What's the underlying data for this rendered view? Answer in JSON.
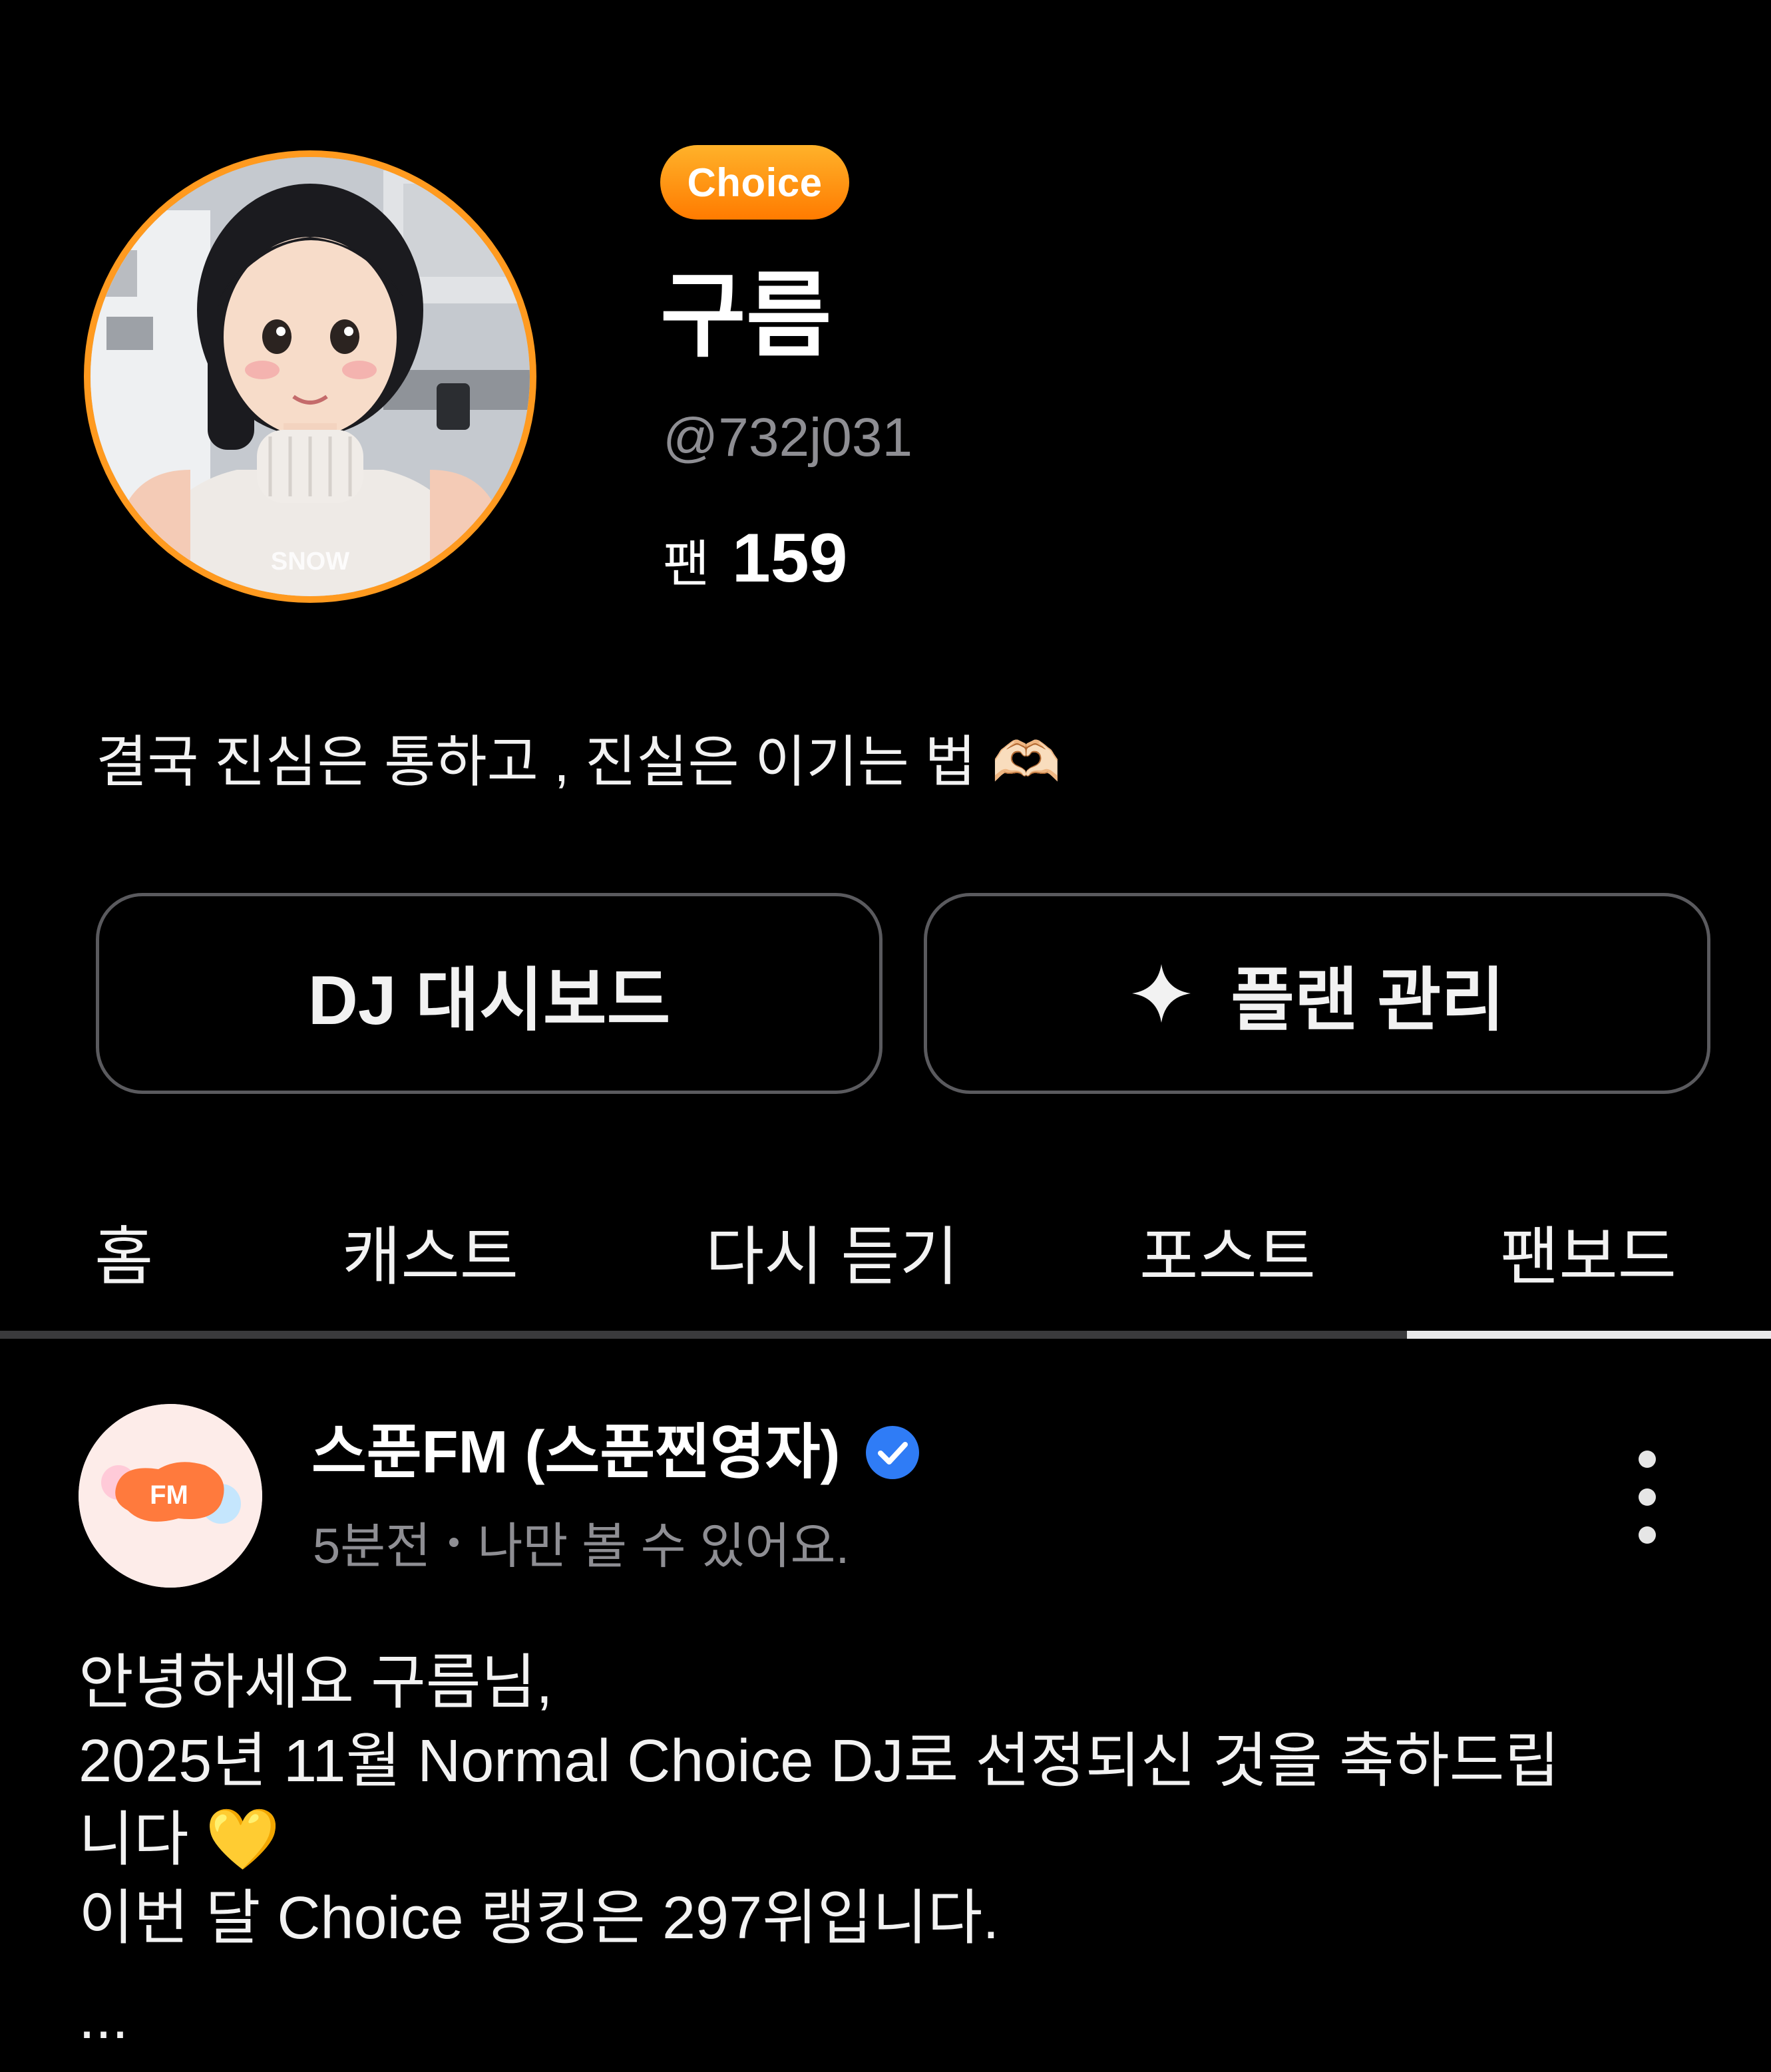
{
  "profile": {
    "badge": "Choice",
    "nickname": "구름",
    "handle": "@732j031",
    "fans_label": "팬",
    "fans_count": "159",
    "avatar_watermark": "SNOW",
    "bio": "결국 진심은 통하고 , 진실은 이기는 법",
    "bio_emoji": "🫶🏻"
  },
  "buttons": {
    "dj_dashboard": "DJ 대시보드",
    "plan_manage": "플랜 관리"
  },
  "tabs": [
    {
      "label": "홈"
    },
    {
      "label": "캐스트"
    },
    {
      "label": "다시 듣기"
    },
    {
      "label": "포스트"
    },
    {
      "label": "팬보드"
    }
  ],
  "active_tab": "팬보드",
  "post": {
    "author": "스푼FM (스푼찐영자)",
    "avatar_text": "FM",
    "time": "5분전",
    "visibility": "나만 볼 수 있어요.",
    "lines": [
      "안녕하세요 구름님,",
      "2025년 11월 Normal Choice DJ로 선정되신 것을 축하드립",
      "니다",
      "이번 달 Choice 랭킹은 297위입니다."
    ],
    "heart_emoji": "💛",
    "more": "..."
  },
  "colors": {
    "background": "#000000",
    "accent_orange": "#ff8a00",
    "verified_blue": "#2f7cf6",
    "muted_text": "#8e8e93"
  }
}
